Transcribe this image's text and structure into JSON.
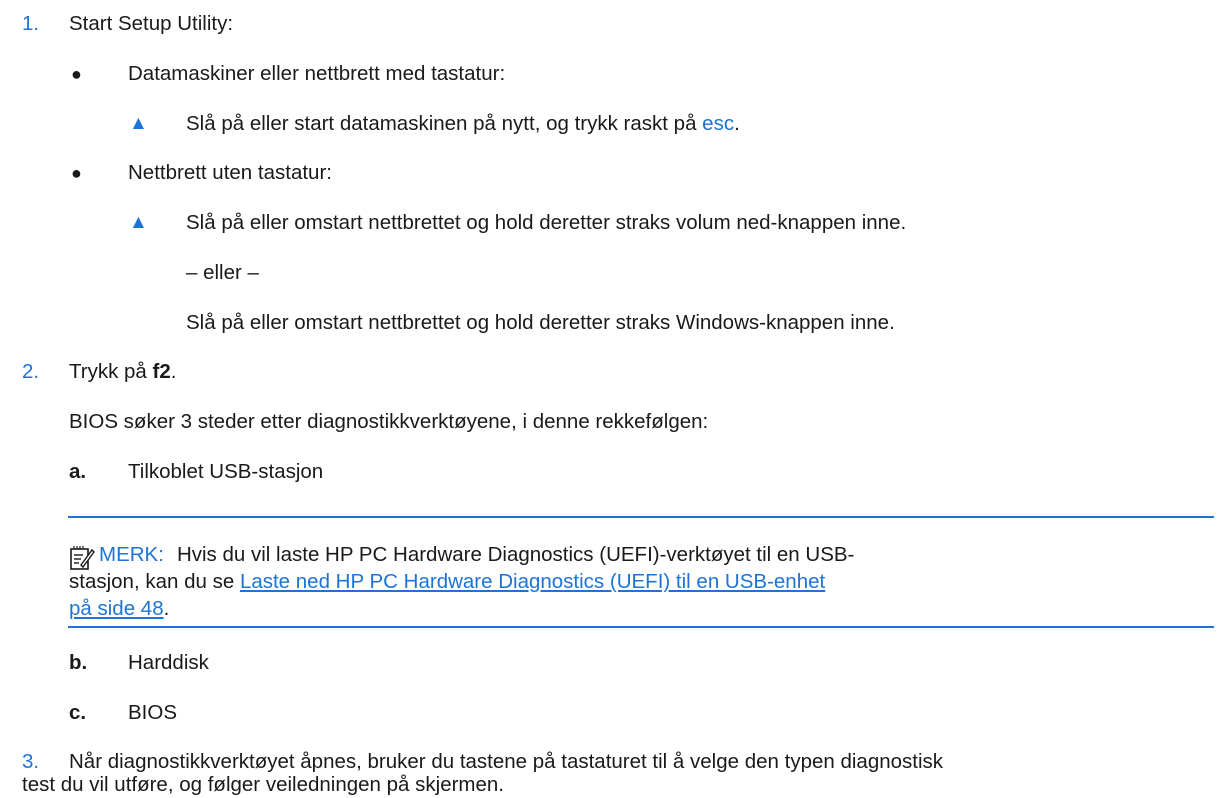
{
  "step1": {
    "number": "1.",
    "text": "Start Setup Utility:",
    "bullet_a": {
      "marker": "●",
      "text": "Datamaskiner eller nettbrett med tastatur:",
      "action_marker": "▲",
      "action_text": "Slå på eller start datamaskinen på nytt, og trykk raskt på ",
      "action_key": "esc",
      "action_end": "."
    },
    "bullet_b": {
      "marker": "●",
      "text": "Nettbrett uten tastatur:",
      "action_marker": "▲",
      "action_text": "Slå på eller omstart nettbrettet og hold deretter straks volum ned-knappen inne.",
      "or_text": "– eller –",
      "alt_text": "Slå på eller omstart nettbrettet og hold deretter straks Windows-knappen inne."
    }
  },
  "step2": {
    "number": "2.",
    "text": "Trykk på ",
    "key": "f2",
    "end": ".",
    "intro": "BIOS søker 3 steder etter diagnostikkverktøyene, i denne rekkefølgen:",
    "items": [
      {
        "letter": "a.",
        "text": "Tilkoblet USB-stasjon"
      },
      {
        "letter": "b.",
        "text": "Harddisk"
      },
      {
        "letter": "c.",
        "text": "BIOS"
      }
    ],
    "note": {
      "label": "MERK:",
      "text_line1": "Hvis du vil laste HP PC Hardware Diagnostics (UEFI)-verktøyet til en USB-",
      "text_line2": "stasjon, kan du se ",
      "link_line2": "Laste ned HP PC Hardware Diagnostics (UEFI) til en USB-enhet",
      "link_line3": "på side 48",
      "end": "."
    }
  },
  "step3": {
    "number": "3.",
    "text_line1": "Når diagnostikkverktøyet åpnes, bruker du tastene på tastaturet til å velge den typen diagnostisk",
    "text_line2": "test du vil utføre, og følger veiledningen på skjermen."
  }
}
